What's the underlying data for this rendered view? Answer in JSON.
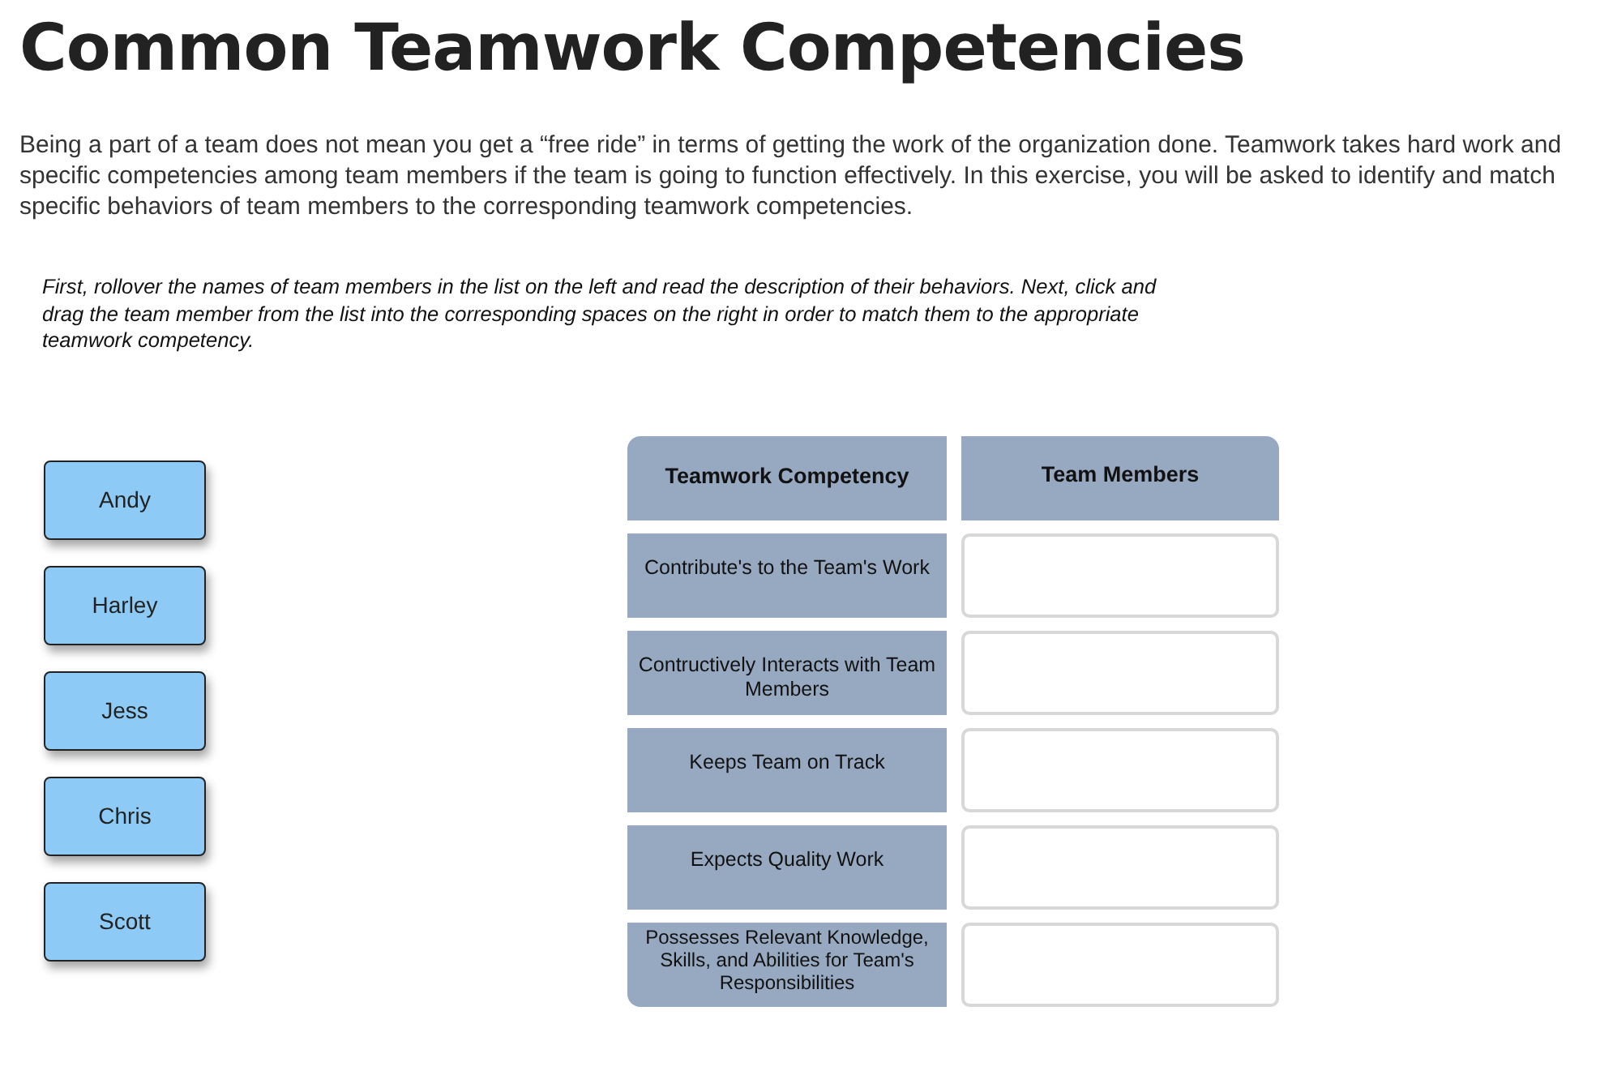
{
  "title": "Common Teamwork Competencies",
  "intro": "Being a part of a team does not mean you get a “free ride” in terms of getting the work of the organization done. Teamwork takes hard work and specific competencies among team members if the team is going to function effectively. In this exercise, you will be asked to identify and match specific behaviors of team members to the corresponding teamwork competencies.",
  "instructions": "First, rollover the names of team members in the list on the left and read the description of their behaviors. Next, click and drag the team member from the list into the corresponding spaces on the right in order to match them to the appropriate teamwork competency.",
  "team_members": [
    "Andy",
    "Harley",
    "Jess",
    "Chris",
    "Scott"
  ],
  "table": {
    "columns": [
      "Teamwork Competency",
      "Team Members"
    ],
    "rows": [
      {
        "competency": "Contribute's to the Team's Work"
      },
      {
        "competency": "Contructively Interacts with Team Members"
      },
      {
        "competency": "Keeps Team on Track"
      },
      {
        "competency": "Expects Quality Work"
      },
      {
        "competency": "Possesses Relevant Knowledge, Skills, and Abilities for Team's Responsibilities"
      }
    ]
  }
}
